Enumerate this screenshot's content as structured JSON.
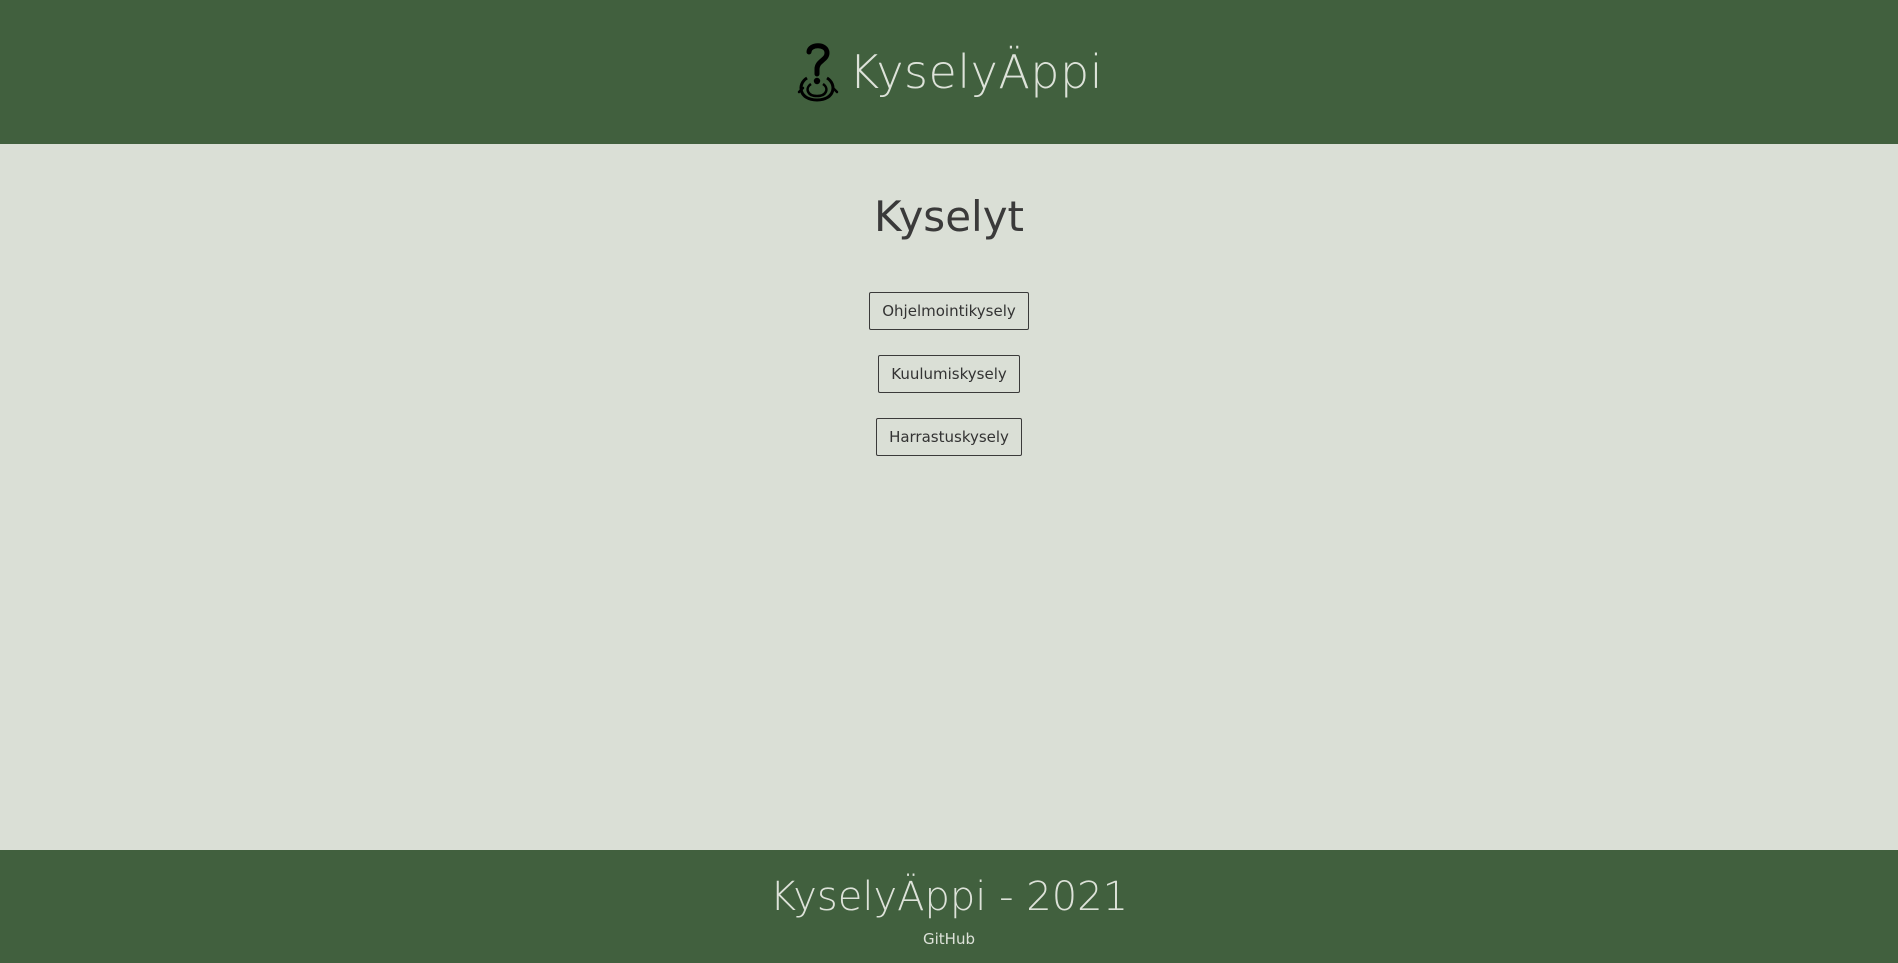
{
  "header": {
    "logo_icon": "question-mark-hook-icon",
    "title": "KyselyÄppi"
  },
  "main": {
    "title": "Kyselyt",
    "surveys": [
      {
        "label": "Ohjelmointikysely"
      },
      {
        "label": "Kuulumiskysely"
      },
      {
        "label": "Harrastuskysely"
      }
    ]
  },
  "footer": {
    "title": "KyselyÄppi - 2021",
    "link_label": "GitHub"
  },
  "colors": {
    "header_bg": "#41603e",
    "main_bg": "#dadfd6",
    "header_text": "#dde2d9",
    "body_text": "#3a3a3a"
  }
}
